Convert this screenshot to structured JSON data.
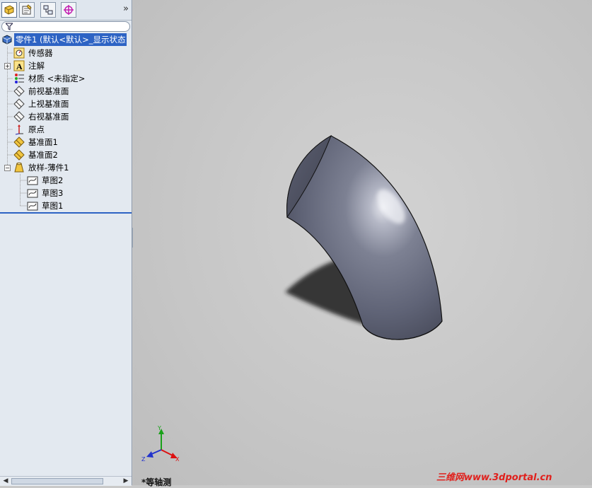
{
  "feature_tree": {
    "root": "零件1  (默认<默认>_显示状态",
    "items": [
      {
        "label": "传感器",
        "icon": "sensor-icon"
      },
      {
        "label": "注解",
        "icon": "annotation-icon",
        "expandable": true
      },
      {
        "label": "材质 <未指定>",
        "icon": "material-icon"
      },
      {
        "label": "前视基准面",
        "icon": "plane-icon"
      },
      {
        "label": "上视基准面",
        "icon": "plane-icon"
      },
      {
        "label": "右视基准面",
        "icon": "plane-icon"
      },
      {
        "label": "原点",
        "icon": "origin-icon"
      },
      {
        "label": "基准面1",
        "icon": "ref-plane-icon"
      },
      {
        "label": "基准面2",
        "icon": "ref-plane-icon"
      },
      {
        "label": "放样-薄件1",
        "icon": "loft-feature-icon",
        "expanded": true
      },
      {
        "label": "草图2",
        "icon": "sketch-icon"
      },
      {
        "label": "草图3",
        "icon": "sketch-icon"
      },
      {
        "label": "草图1",
        "icon": "sketch-icon"
      }
    ]
  },
  "tabs": [
    "FeatureManager",
    "PropertyManager",
    "ConfigurationManager",
    "DimXpertManager"
  ],
  "more_label": "»",
  "triad": {
    "x": "X",
    "y": "Y",
    "z": "Z"
  },
  "view_name": "*等轴测",
  "watermark": "三维网www.3dportal.cn",
  "colors": {
    "selection": "#2d63c4",
    "background": "#c9c9c9",
    "model": "#6b7082"
  }
}
